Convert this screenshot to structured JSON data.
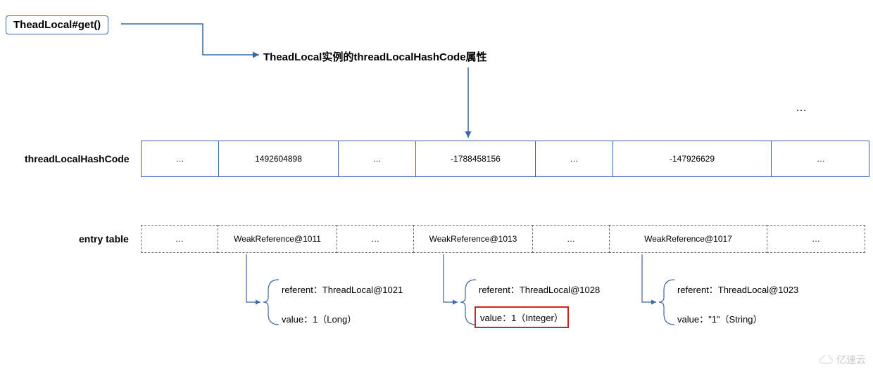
{
  "title": "TheadLocal#get()",
  "subtitle": "TheadLocal实例的threadLocalHashCode属性",
  "topEllipsis": "…",
  "hashLabel": "threadLocalHashCode",
  "entryLabel": "entry table",
  "hashCells": [
    "…",
    "1492604898",
    "…",
    "-1788458156",
    "…",
    "-147926629",
    "…"
  ],
  "entryCells": [
    "…",
    "WeakReference@1011",
    "…",
    "WeakReference@1013",
    "…",
    "WeakReference@1017",
    "…"
  ],
  "details": [
    {
      "referent": "referent：ThreadLocal@1021",
      "value": "value：1（Long）"
    },
    {
      "referent": "referent：ThreadLocal@1028",
      "value": "value：1（Integer）"
    },
    {
      "referent": "referent：ThreadLocal@1023",
      "value": "value：\"1\"（String）"
    }
  ],
  "watermark": "亿速云"
}
